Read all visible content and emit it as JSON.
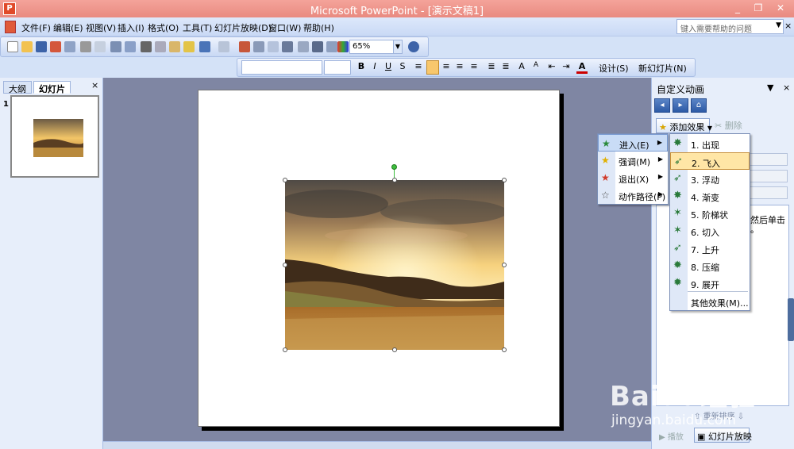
{
  "window": {
    "title": "Microsoft PowerPoint - [演示文稿1]",
    "app_icon": "P",
    "controls": [
      "_",
      "❐",
      "✕"
    ]
  },
  "menubar": {
    "items": [
      "文件(F)",
      "编辑(E)",
      "视图(V)",
      "插入(I)",
      "格式(O)",
      "工具(T)",
      "幻灯片放映(D)",
      "窗口(W)",
      "帮助(H)"
    ],
    "help_placeholder": "键入需要帮助的问题",
    "close": "×"
  },
  "toolbar": {
    "zoom": "65%",
    "design_label": "设计(S)",
    "new_slide_label": "新幻灯片(N)"
  },
  "left_panel": {
    "tabs": [
      "大纲",
      "幻灯片"
    ],
    "active_tab": "幻灯片",
    "close": "×",
    "slide_number": "1"
  },
  "task_pane": {
    "title": "自定义动画",
    "add_effect_label": "添加效果",
    "delete_label": "删除",
    "hint_text": "然后单击",
    "hint_text2": "。",
    "reorder_label": "重新排序",
    "play_label": "播放",
    "slideshow_label": "幻灯片放映"
  },
  "effect_menu": {
    "items": [
      {
        "label": "进入(E)",
        "icon": "star-green-icon"
      },
      {
        "label": "强调(M)",
        "icon": "star-yellow-icon"
      },
      {
        "label": "退出(X)",
        "icon": "star-red-icon"
      },
      {
        "label": "动作路径(P)",
        "icon": "star-outline-icon"
      }
    ],
    "highlighted": "进入(E)"
  },
  "entrance_menu": {
    "items": [
      "1. 出现",
      "2. 飞入",
      "3. 浮动",
      "4. 渐变",
      "5. 阶梯状",
      "6. 切入",
      "7. 上升",
      "8. 压缩",
      "9. 展开"
    ],
    "more": "其他效果(M)...",
    "highlighted": "2. 飞入"
  },
  "watermark": {
    "brand": "Baidu经验",
    "url": "jingyan.baidu.com"
  }
}
